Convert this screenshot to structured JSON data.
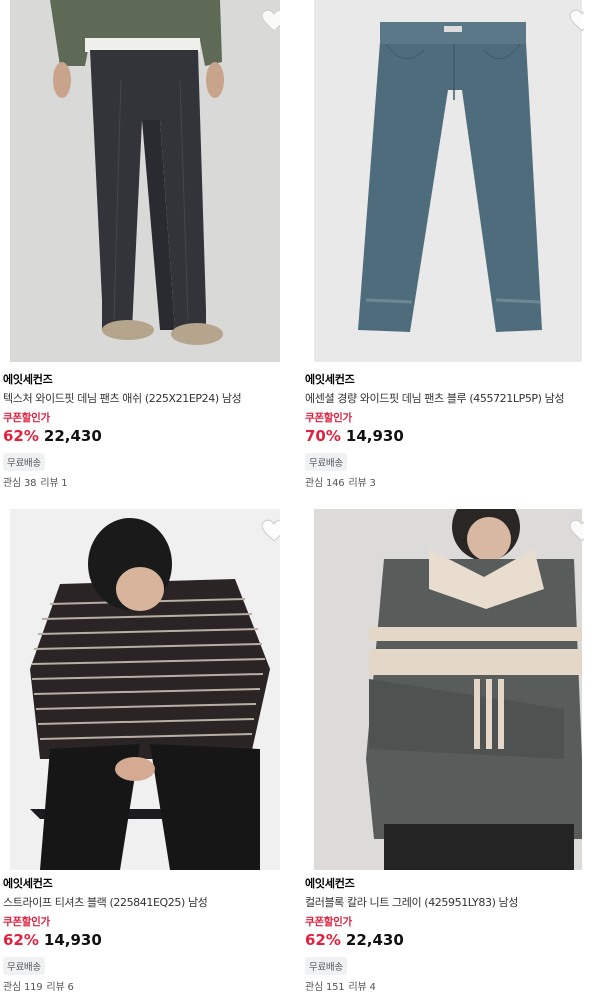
{
  "products": [
    {
      "brand": "에잇세컨즈",
      "title": "텍스처 와이드핏 데님 팬츠 애쉬 (225X21EP24) 남성",
      "coupon_label": "쿠폰할인가",
      "discount": "62%",
      "price": "22,430",
      "shipping_tag": "무료배송",
      "interest": "관심 38",
      "reviews": "리뷰 1",
      "image": "wide-denim-ash-photo",
      "wishlist_icon": "heart-icon"
    },
    {
      "brand": "에잇세컨즈",
      "title": "에센셜 경량 와이드핏 데님 팬츠 블루 (455721LP5P) 남성",
      "coupon_label": "쿠폰할인가",
      "discount": "70%",
      "price": "14,930",
      "shipping_tag": "무료배송",
      "interest": "관심 146",
      "reviews": "리뷰 3",
      "image": "wide-denim-blue-photo",
      "wishlist_icon": "heart-icon"
    },
    {
      "brand": "에잇세컨즈",
      "title": "스트라이프 티셔츠 블랙 (225841EQ25) 남성",
      "coupon_label": "쿠폰할인가",
      "discount": "62%",
      "price": "14,930",
      "shipping_tag": "무료배송",
      "interest": "관심 119",
      "reviews": "리뷰 6",
      "image": "stripe-tshirt-black-photo",
      "wishlist_icon": "heart-icon"
    },
    {
      "brand": "에잇세컨즈",
      "title": "컬러블록 칼라 니트 그레이 (425951LY83) 남성",
      "coupon_label": "쿠폰할인가",
      "discount": "62%",
      "price": "22,430",
      "shipping_tag": "무료배송",
      "interest": "관심 151",
      "reviews": "리뷰 4",
      "image": "colorblock-collar-knit-photo",
      "wishlist_icon": "heart-icon"
    }
  ],
  "colors": {
    "discount": "#e0223f",
    "coupon": "#e0223f",
    "tag_bg": "#f0f1f3"
  }
}
